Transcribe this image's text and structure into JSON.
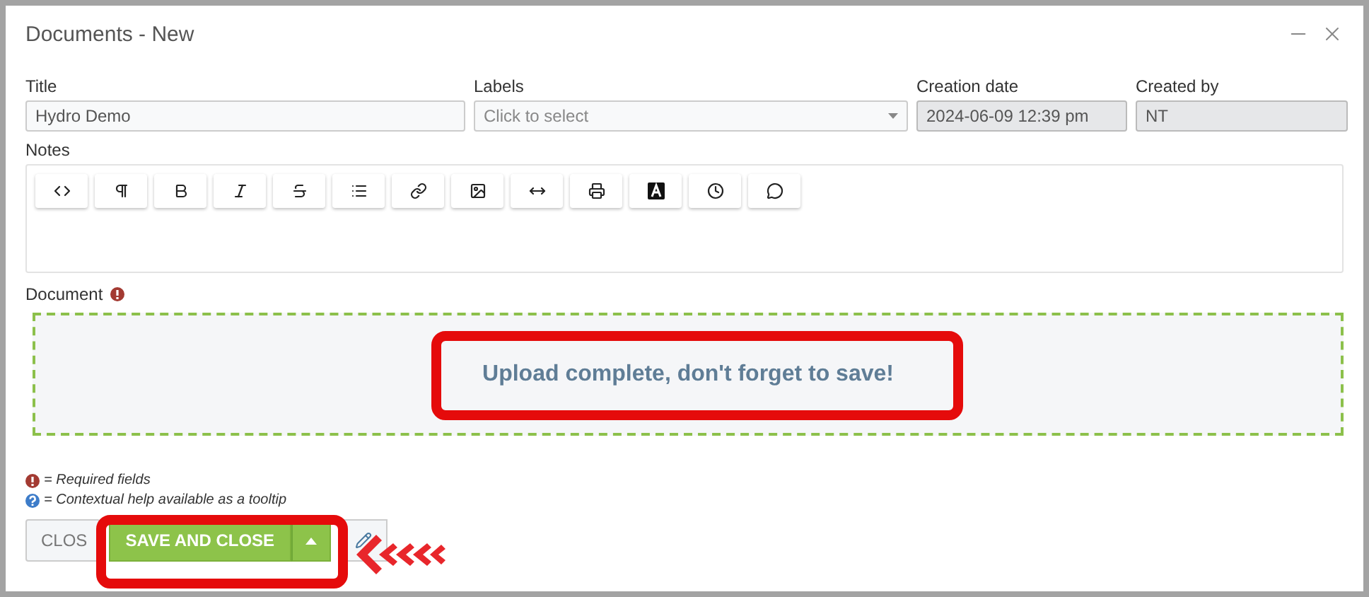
{
  "window": {
    "title": "Documents - New"
  },
  "fields": [
    {
      "label": "Title",
      "value": "Hydro Demo",
      "kind": "text",
      "disabled": false
    },
    {
      "label": "Labels",
      "placeholder": "Click to select",
      "kind": "select",
      "disabled": false
    },
    {
      "label": "Creation date",
      "value": "2024-06-09 12:39 pm",
      "kind": "text",
      "disabled": true
    },
    {
      "label": "Created by",
      "value": "NT",
      "kind": "text",
      "disabled": true
    }
  ],
  "notes": {
    "label": "Notes"
  },
  "document": {
    "label": "Document",
    "required": true,
    "message": "Upload complete, don't forget to save!"
  },
  "legend": [
    {
      "kind": "required",
      "text": "= Required fields"
    },
    {
      "kind": "help",
      "text": "= Contextual help available as a tooltip"
    }
  ],
  "buttons": [
    {
      "kind": "plain",
      "label": "CLOS"
    },
    {
      "kind": "primary",
      "label": "SAVE AND CLOSE"
    }
  ]
}
